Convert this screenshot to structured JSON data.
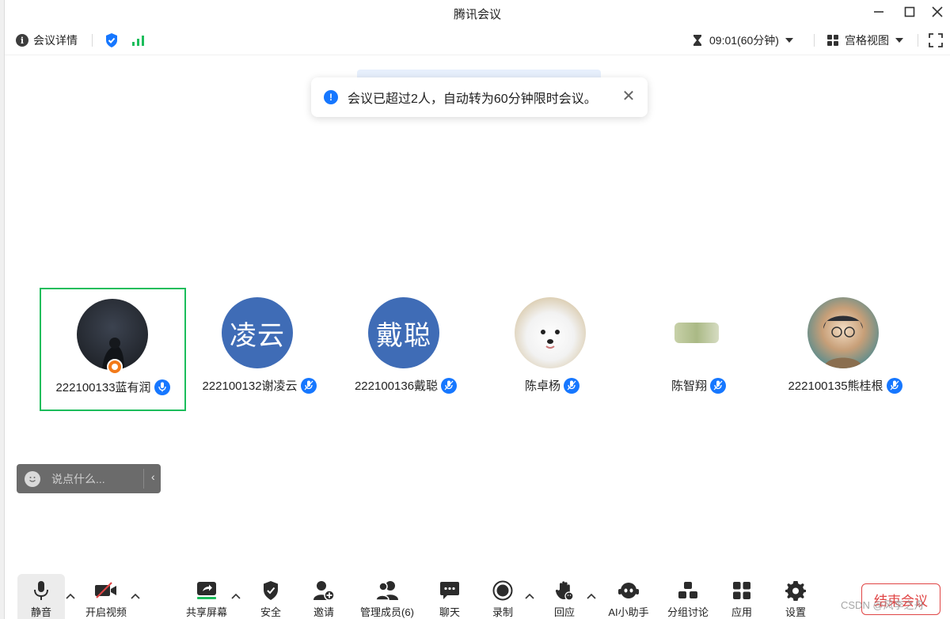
{
  "window": {
    "title": "腾讯会议",
    "minimize_icon": "minimize-icon",
    "maximize_icon": "maximize-icon",
    "close_icon": "close-icon"
  },
  "toolbar": {
    "details_label": "会议详情",
    "timer": "09:01(60分钟)",
    "view_label": "宫格视图"
  },
  "notice": {
    "text": "会议已超过2人，自动转为60分钟限时会议。",
    "close": "✕"
  },
  "participants": [
    {
      "name": "222100133蓝有润",
      "avatar_text": "",
      "avatar_style": "dark",
      "host": true,
      "active": true
    },
    {
      "name": "222100132谢凌云",
      "avatar_text": "凌云",
      "avatar_style": "text",
      "host": false,
      "active": false
    },
    {
      "name": "222100136戴聪",
      "avatar_text": "戴聪",
      "avatar_style": "text",
      "host": false,
      "active": false
    },
    {
      "name": "陈卓杨",
      "avatar_text": "",
      "avatar_style": "dog",
      "host": false,
      "active": false
    },
    {
      "name": "陈智翔",
      "avatar_text": "",
      "avatar_style": "small",
      "host": false,
      "active": false
    },
    {
      "name": "222100135熊桂根",
      "avatar_text": "",
      "avatar_style": "anime",
      "host": false,
      "active": false
    }
  ],
  "chat": {
    "placeholder": "说点什么...",
    "toggle": "‹"
  },
  "bottom": {
    "mute": "静音",
    "video": "开启视频",
    "share": "共享屏幕",
    "security": "安全",
    "invite": "邀请",
    "members": "管理成员(6)",
    "chat": "聊天",
    "record": "录制",
    "react": "回应",
    "ai": "AI小助手",
    "breakout": "分组讨论",
    "apps": "应用",
    "settings": "设置",
    "end": "结束会议"
  },
  "watermark": "CSDN @风李之舟",
  "colors": {
    "accent": "#1677ff",
    "active_border": "#1bbd5b",
    "end_red": "#e04545",
    "avatar_blue": "#3f6cb6"
  }
}
